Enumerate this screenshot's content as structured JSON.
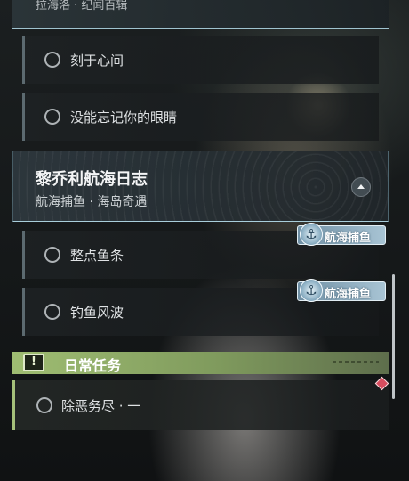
{
  "top_card": {
    "subtitle": "拉海洛 · 纪闻百辑"
  },
  "upper_tasks": [
    {
      "label": "刻于心间"
    },
    {
      "label": "没能忘记你的眼睛"
    }
  ],
  "chapter": {
    "title": "黎乔利航海日志",
    "subtitle": "航海捕鱼 · 海岛奇遇",
    "tasks": [
      {
        "label": "整点鱼条",
        "tag": "航海捕鱼"
      },
      {
        "label": "钓鱼风波",
        "tag": "航海捕鱼"
      }
    ]
  },
  "daily": {
    "header": "日常任务",
    "badge": "!",
    "tasks": [
      {
        "label": "除恶务尽 · 一"
      }
    ]
  },
  "colors": {
    "accent_green": "#9fbd72",
    "accent_blue": "#a9cedb",
    "tag_blue": "#8fb2c6",
    "alert_red": "#d74d5f"
  },
  "icons": {
    "task_status": "circle-outline-icon",
    "collapse": "chevron-up-icon",
    "tag_badge": "anchor-icon",
    "daily_badge": "exclamation-icon",
    "alert": "diamond-marker-icon"
  }
}
